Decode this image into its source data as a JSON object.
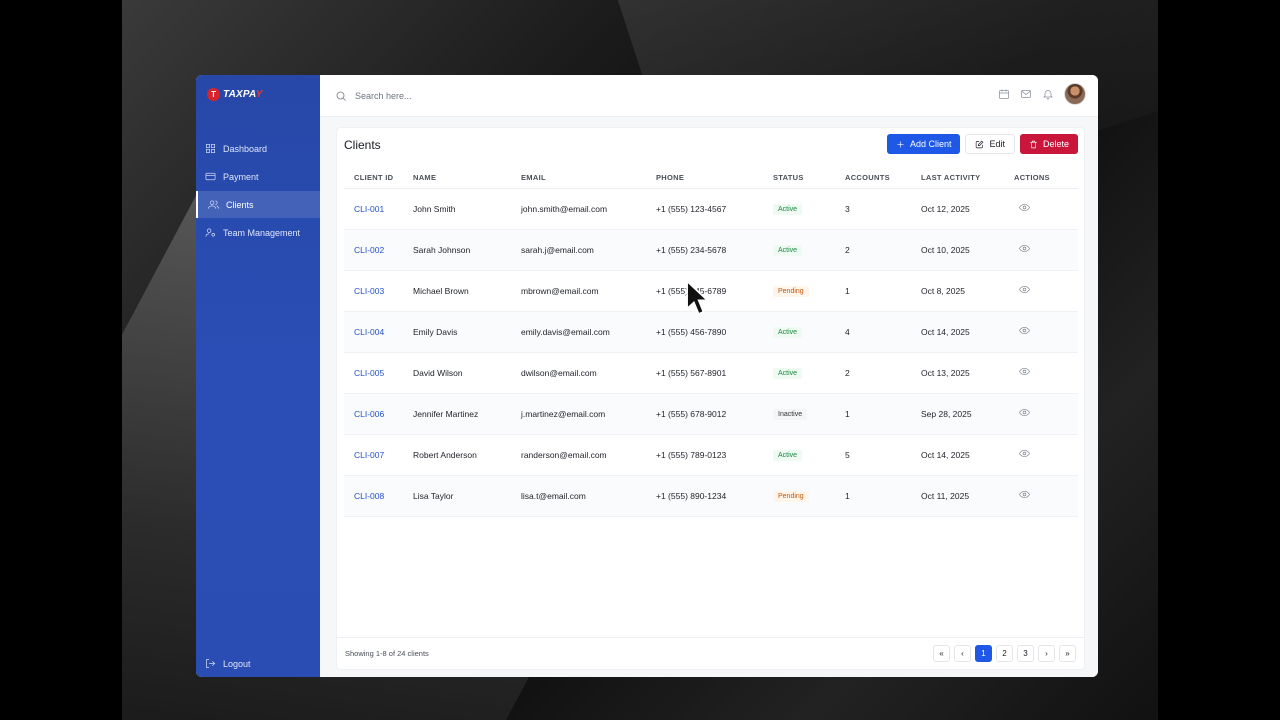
{
  "brand": {
    "name_part1": "TA",
    "name_part2": "XPA",
    "name_part3": "Y"
  },
  "sidebar": {
    "items": [
      {
        "label": "Dashboard",
        "icon": "grid-icon"
      },
      {
        "label": "Payment",
        "icon": "card-icon"
      },
      {
        "label": "Clients",
        "icon": "users-icon"
      },
      {
        "label": "Team Management",
        "icon": "user-cog-icon"
      }
    ],
    "active": "Clients",
    "logout_label": "Logout"
  },
  "header": {
    "search_placeholder": "Search here..."
  },
  "page": {
    "title": "Clients"
  },
  "toolbar": {
    "add_label": "Add Client",
    "edit_label": "Edit",
    "delete_label": "Delete"
  },
  "table": {
    "columns": [
      "CLIENT ID",
      "NAME",
      "EMAIL",
      "PHONE",
      "STATUS",
      "ACCOUNTS",
      "LAST ACTIVITY",
      "ACTIONS"
    ],
    "rows": [
      {
        "id": "CLI-001",
        "name": "John Smith",
        "email": "john.smith@email.com",
        "phone": "+1 (555) 123-4567",
        "status": "Active",
        "accounts": "3",
        "last": "Oct 12, 2025"
      },
      {
        "id": "CLI-002",
        "name": "Sarah Johnson",
        "email": "sarah.j@email.com",
        "phone": "+1 (555) 234-5678",
        "status": "Active",
        "accounts": "2",
        "last": "Oct 10, 2025"
      },
      {
        "id": "CLI-003",
        "name": "Michael Brown",
        "email": "mbrown@email.com",
        "phone": "+1 (555) 345-6789",
        "status": "Pending",
        "accounts": "1",
        "last": "Oct 8, 2025"
      },
      {
        "id": "CLI-004",
        "name": "Emily Davis",
        "email": "emily.davis@email.com",
        "phone": "+1 (555) 456-7890",
        "status": "Active",
        "accounts": "4",
        "last": "Oct 14, 2025"
      },
      {
        "id": "CLI-005",
        "name": "David Wilson",
        "email": "dwilson@email.com",
        "phone": "+1 (555) 567-8901",
        "status": "Active",
        "accounts": "2",
        "last": "Oct 13, 2025"
      },
      {
        "id": "CLI-006",
        "name": "Jennifer Martinez",
        "email": "j.martinez@email.com",
        "phone": "+1 (555) 678-9012",
        "status": "Inactive",
        "accounts": "1",
        "last": "Sep 28, 2025"
      },
      {
        "id": "CLI-007",
        "name": "Robert Anderson",
        "email": "randerson@email.com",
        "phone": "+1 (555) 789-0123",
        "status": "Active",
        "accounts": "5",
        "last": "Oct 14, 2025"
      },
      {
        "id": "CLI-008",
        "name": "Lisa Taylor",
        "email": "lisa.t@email.com",
        "phone": "+1 (555) 890-1234",
        "status": "Pending",
        "accounts": "1",
        "last": "Oct 11, 2025"
      }
    ]
  },
  "footer": {
    "showing": "Showing 1-8 of 24 clients",
    "pages": [
      "«",
      "‹",
      "1",
      "2",
      "3",
      "›",
      "»"
    ],
    "current_page": "1"
  },
  "colors": {
    "sidebar": "#2a4db3",
    "primary": "#1f57e6",
    "danger": "#c8173a",
    "link": "#2351c9"
  }
}
